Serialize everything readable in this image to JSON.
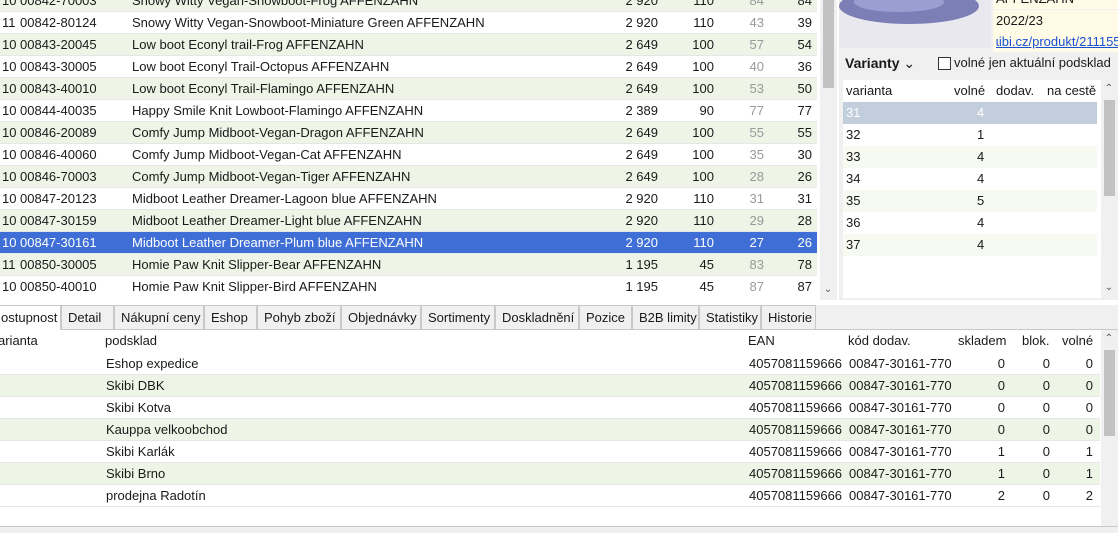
{
  "products": [
    {
      "grp": "10",
      "code": "00842-70003",
      "name": "Snowy Witty Vegan-Snowboot-Frog AFFENZAHN",
      "price": "2 920",
      "qty": "110",
      "a": "84",
      "b": "84"
    },
    {
      "grp": "11",
      "code": "00842-80124",
      "name": "Snowy Witty Vegan-Snowboot-Miniature Green AFFENZAHN",
      "price": "2 920",
      "qty": "110",
      "a": "43",
      "b": "39"
    },
    {
      "grp": "10",
      "code": "00843-20045",
      "name": "Low boot Econyl trail-Frog AFFENZAHN",
      "price": "2 649",
      "qty": "100",
      "a": "57",
      "b": "54"
    },
    {
      "grp": "10",
      "code": "00843-30005",
      "name": "Low boot Econyl Trail-Octopus AFFENZAHN",
      "price": "2 649",
      "qty": "100",
      "a": "40",
      "b": "36"
    },
    {
      "grp": "10",
      "code": "00843-40010",
      "name": "Low boot Econyl Trail-Flamingo AFFENZAHN",
      "price": "2 649",
      "qty": "100",
      "a": "53",
      "b": "50"
    },
    {
      "grp": "10",
      "code": "00844-40035",
      "name": "Happy Smile Knit Lowboot-Flamingo AFFENZAHN",
      "price": "2 389",
      "qty": "90",
      "a": "77",
      "b": "77"
    },
    {
      "grp": "10",
      "code": "00846-20089",
      "name": "Comfy Jump Midboot-Vegan-Dragon AFFENZAHN",
      "price": "2 649",
      "qty": "100",
      "a": "55",
      "b": "55"
    },
    {
      "grp": "10",
      "code": "00846-40060",
      "name": "Comfy Jump Midboot-Vegan-Cat AFFENZAHN",
      "price": "2 649",
      "qty": "100",
      "a": "35",
      "b": "30"
    },
    {
      "grp": "10",
      "code": "00846-70003",
      "name": "Comfy Jump Midboot-Vegan-Tiger AFFENZAHN",
      "price": "2 649",
      "qty": "100",
      "a": "28",
      "b": "26"
    },
    {
      "grp": "10",
      "code": "00847-20123",
      "name": "Midboot Leather Dreamer-Lagoon blue AFFENZAHN",
      "price": "2 920",
      "qty": "110",
      "a": "31",
      "b": "31"
    },
    {
      "grp": "10",
      "code": "00847-30159",
      "name": "Midboot Leather Dreamer-Light blue AFFENZAHN",
      "price": "2 920",
      "qty": "110",
      "a": "29",
      "b": "28"
    },
    {
      "grp": "10",
      "code": "00847-30161",
      "name": "Midboot Leather Dreamer-Plum blue AFFENZAHN",
      "price": "2 920",
      "qty": "110",
      "a": "27",
      "b": "26"
    },
    {
      "grp": "11",
      "code": "00850-30005",
      "name": "Homie Paw Knit Slipper-Bear AFFENZAHN",
      "price": "1 195",
      "qty": "45",
      "a": "83",
      "b": "78"
    },
    {
      "grp": "10",
      "code": "00850-40010",
      "name": "Homie Paw Knit Slipper-Bird AFFENZAHN",
      "price": "1 195",
      "qty": "45",
      "a": "87",
      "b": "87"
    }
  ],
  "product_info": {
    "brand": "AFFENZAHN",
    "season": "2022/23",
    "link": "ɩibi.cz/produkt/211155"
  },
  "variants": {
    "title": "Varianty",
    "checkbox_label": "volné jen aktuální podsklad",
    "headers": {
      "variant": "varianta",
      "free": "volné",
      "supplier": "dodav.",
      "transit": "na cestě"
    },
    "rows": [
      {
        "variant": "31",
        "free": "4"
      },
      {
        "variant": "32",
        "free": "1"
      },
      {
        "variant": "33",
        "free": "4"
      },
      {
        "variant": "34",
        "free": "4"
      },
      {
        "variant": "35",
        "free": "5"
      },
      {
        "variant": "36",
        "free": "4"
      },
      {
        "variant": "37",
        "free": "4"
      }
    ]
  },
  "tabs": [
    "ostupnost",
    "Detail",
    "Nákupní ceny",
    "Eshop",
    "Pohyb zboží",
    "Objednávky",
    "Sortimenty",
    "Doskladnění",
    "Pozice",
    "B2B limity",
    "Statistiky",
    "Historie"
  ],
  "stock": {
    "headers": {
      "variant": "arianta",
      "warehouse": "podsklad",
      "ean": "EAN",
      "supplier_code": "kód dodav.",
      "in_stock": "skladem",
      "blocked": "blok.",
      "free": "volné"
    },
    "rows": [
      {
        "warehouse": "Eshop expedice",
        "ean": "4057081159666",
        "supplier_code": "00847-30161-770",
        "in_stock": "0",
        "blocked": "0",
        "free": "0"
      },
      {
        "warehouse": "Skibi DBK",
        "ean": "4057081159666",
        "supplier_code": "00847-30161-770",
        "in_stock": "0",
        "blocked": "0",
        "free": "0"
      },
      {
        "warehouse": "Skibi Kotva",
        "ean": "4057081159666",
        "supplier_code": "00847-30161-770",
        "in_stock": "0",
        "blocked": "0",
        "free": "0"
      },
      {
        "warehouse": "Kauppa velkoobchod",
        "ean": "4057081159666",
        "supplier_code": "00847-30161-770",
        "in_stock": "0",
        "blocked": "0",
        "free": "0"
      },
      {
        "warehouse": "Skibi Karlák",
        "ean": "4057081159666",
        "supplier_code": "00847-30161-770",
        "in_stock": "1",
        "blocked": "0",
        "free": "1"
      },
      {
        "warehouse": "Skibi Brno",
        "ean": "4057081159666",
        "supplier_code": "00847-30161-770",
        "in_stock": "1",
        "blocked": "0",
        "free": "1"
      },
      {
        "warehouse": "prodejna Radotín",
        "ean": "4057081159666",
        "supplier_code": "00847-30161-770",
        "in_stock": "2",
        "blocked": "0",
        "free": "2"
      }
    ]
  }
}
